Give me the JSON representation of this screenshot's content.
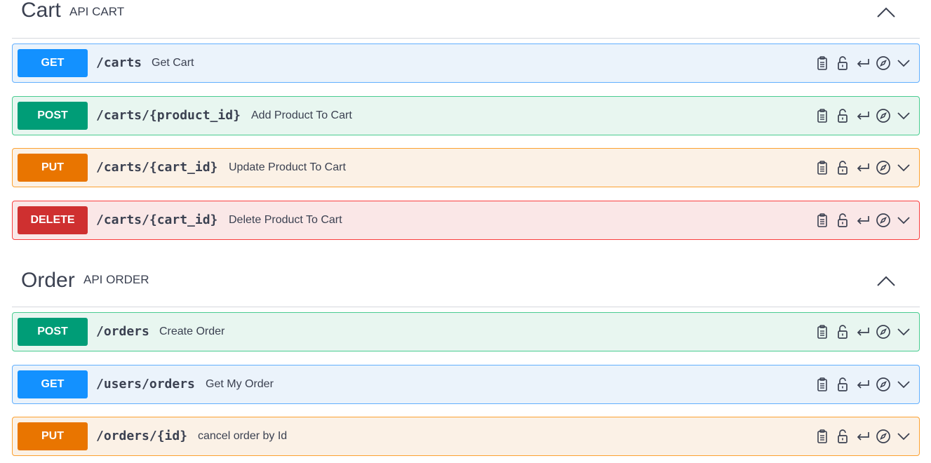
{
  "sections": [
    {
      "title": "Cart",
      "description": "API CART",
      "operations": [
        {
          "method": "GET",
          "path": "/carts",
          "summary": "Get Cart"
        },
        {
          "method": "POST",
          "path": "/carts/{product_id}",
          "summary": "Add Product To Cart"
        },
        {
          "method": "PUT",
          "path": "/carts/{cart_id}",
          "summary": "Update Product To Cart"
        },
        {
          "method": "DELETE",
          "path": "/carts/{cart_id}",
          "summary": "Delete Product To Cart"
        }
      ]
    },
    {
      "title": "Order",
      "description": "API ORDER",
      "operations": [
        {
          "method": "POST",
          "path": "/orders",
          "summary": "Create Order"
        },
        {
          "method": "GET",
          "path": "/users/orders",
          "summary": "Get My Order"
        },
        {
          "method": "PUT",
          "path": "/orders/{id}",
          "summary": "cancel order by Id"
        }
      ]
    }
  ],
  "icons": [
    "clipboard-icon",
    "unlock-icon",
    "return-icon",
    "compass-icon",
    "chevron-down-icon"
  ],
  "colors": {
    "get": "#1391ff",
    "post": "#009d77",
    "put": "#e97500",
    "delete": "#cf3030",
    "text": "#3b4151"
  }
}
